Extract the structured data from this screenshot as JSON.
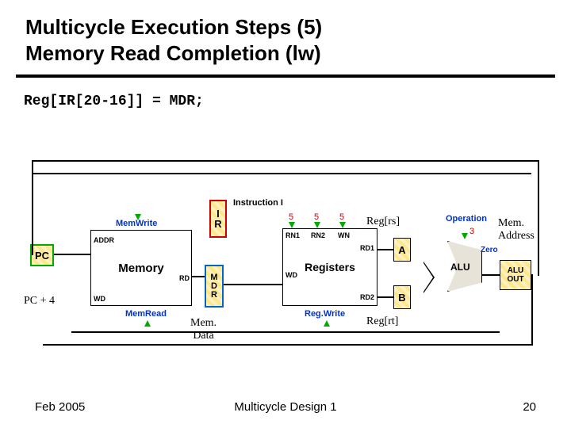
{
  "title_line1": "Multicycle Execution Steps (5)",
  "title_line2": "Memory Read Completion (lw)",
  "code_line": "Reg[IR[20-16]] = MDR;",
  "footer": {
    "left": "Feb 2005",
    "center": "Multicycle Design 1",
    "right": "20"
  },
  "blocks": {
    "pc": "PC",
    "ir": "I\nR",
    "memory": "Memory",
    "mdr": "M\nD\nR",
    "registers": "Registers",
    "a": "A",
    "b": "B",
    "alu": "ALU",
    "aluout": "ALU\nOUT"
  },
  "labels": {
    "instruction_i": "Instruction I",
    "memwrite": "MemWrite",
    "addr": "ADDR",
    "rd_mem": "RD",
    "wd_mem": "WD",
    "memread": "MemRead",
    "rn1": "RN1",
    "rn2": "RN2",
    "wn": "WN",
    "rd1": "RD1",
    "rd2": "RD2",
    "wd_reg": "WD",
    "regwrite": "Reg.Write",
    "operation": "Operation",
    "zero": "Zero",
    "bus5a": "5",
    "bus5b": "5",
    "bus5c": "5",
    "op3": "3"
  },
  "callouts": {
    "pc4": "PC + 4",
    "memdata": "Mem.\nData",
    "regrs": "Reg[rs]",
    "regrt": "Reg[rt]",
    "memaddr": "Mem.\nAddress"
  }
}
